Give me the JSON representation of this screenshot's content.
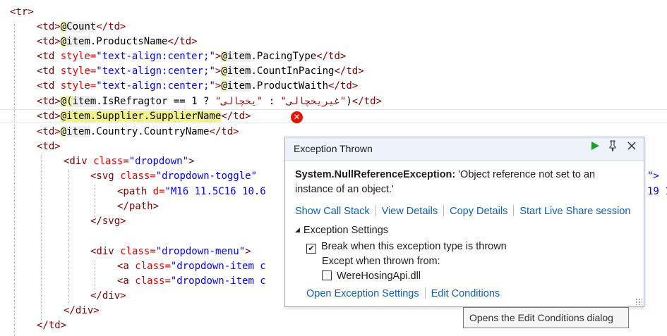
{
  "editor": {
    "lines": [
      {
        "c1": "<tr>"
      },
      {
        "tag_open": "<td>",
        "at": "@",
        "expr": "Count",
        "tag_close": "</td>"
      },
      {
        "tag_open": "<td>",
        "at": "@",
        "item": "item",
        "expr": ".ProductsName",
        "tag_close": "</td>"
      },
      {
        "tag_a": "<td ",
        "attr": "style=",
        "str": "\"text-align:center;\"",
        "tag_b": ">",
        "at": "@",
        "item": "item",
        "expr": ".PacingType",
        "tag_close": "</td>"
      },
      {
        "tag_a": "<td ",
        "attr": "style=",
        "str": "\"text-align:center;\"",
        "tag_b": ">",
        "at": "@",
        "item": "item",
        "expr": ".CountInPacing",
        "tag_close": "</td>"
      },
      {
        "tag_a": "<td ",
        "attr": "style=",
        "str": "\"text-align:center;\"",
        "tag_b": ">",
        "at": "@",
        "item": "item",
        "expr": ".ProductWaith",
        "tag_close": "</td>"
      },
      {
        "tag_open": "<td>",
        "at": "@(",
        "item": "item",
        "expr": ".IsRefragtor == 1 ? ",
        "s1": "\"یخچالی\"",
        "mid": " : ",
        "s2": "\"غیریخچالی\"",
        "end": ")",
        "tag_close": "</td>"
      },
      {
        "tag_open": "<td>",
        "hl": "@item.Supplier.SupplierName",
        "tag_close": "</td>"
      },
      {
        "tag_open": "<td>",
        "at": "@",
        "item": "item",
        "expr": ".Country.CountryName",
        "tag_close": "</td>"
      },
      {
        "c1": "<td>"
      },
      {
        "tag_a": "<div ",
        "attr": "class=",
        "str": "\"dropdown\"",
        "tag_b": ">"
      },
      {
        "tag_a": "<svg ",
        "attr": "class=",
        "str": "\"dropdown-toggle\"",
        "right": "\">"
      },
      {
        "tag_a": "<path ",
        "attr": "d=",
        "str": "\"M16 11.5C16 10.6",
        "right": "19 1"
      },
      {
        "c1": "</path>"
      },
      {
        "c1": "</svg>"
      },
      {
        "c1": ""
      },
      {
        "tag_a": "<div ",
        "attr": "class=",
        "str": "\"dropdown-menu\"",
        "tag_b": ">"
      },
      {
        "tag_a": "<a ",
        "attr": "class=",
        "str": "\"dropdown-item c"
      },
      {
        "tag_a": "<a ",
        "attr": "class=",
        "str": "\"dropdown-item c"
      },
      {
        "c1": "</div>"
      },
      {
        "c1": "</div>"
      },
      {
        "c1": "</td>"
      }
    ]
  },
  "popup": {
    "title": "Exception Thrown",
    "exception_type": "System.NullReferenceException:",
    "message": " 'Object reference not set to an instance of an object.'",
    "links": [
      "Show Call Stack",
      "View Details",
      "Copy Details",
      "Start Live Share session"
    ],
    "settings_heading": "Exception Settings",
    "break_label": "Break when this exception type is thrown",
    "break_checked": "✔",
    "except_label": "Except when thrown from:",
    "module_label": "WereHosingApi.dll",
    "open_settings": "Open Exception Settings",
    "edit_conditions": "Edit Conditions"
  },
  "tooltip": {
    "text": "Opens the Edit Conditions dialog"
  },
  "icons": {
    "error": "error-icon",
    "continue": "play-icon",
    "pin": "pin-icon",
    "close": "close-icon"
  },
  "colors": {
    "tag": "#800000",
    "attr": "#e50000",
    "string": "#0000ff",
    "link": "#0e5fb4",
    "error": "#e51400"
  }
}
